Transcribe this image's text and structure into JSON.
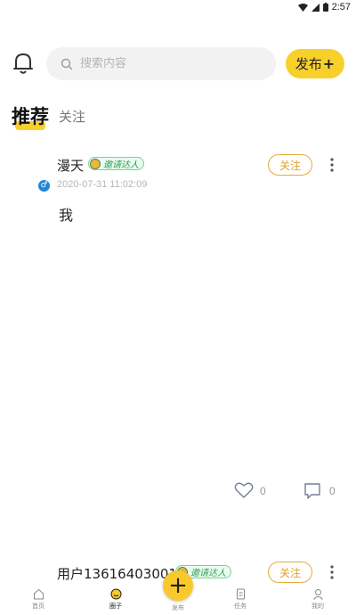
{
  "status_bar": {
    "time": "2:57"
  },
  "header": {
    "search_placeholder": "搜索内容",
    "publish_label": "发布",
    "publish_plus": "+"
  },
  "tabs": [
    {
      "label": "推荐",
      "active": true
    },
    {
      "label": "关注",
      "active": false
    }
  ],
  "posts": [
    {
      "username": "漫天",
      "badge": "邀请达人",
      "time": "2020-07-31 11:02:09",
      "content": "我",
      "follow_label": "关注",
      "likes": "0",
      "comments": "0"
    },
    {
      "username": "用户13616403001",
      "badge": "邀请达人",
      "follow_label": "关注"
    }
  ],
  "bottom_nav": [
    {
      "label": "首页",
      "icon": "home-icon",
      "active": false
    },
    {
      "label": "圈子",
      "icon": "circle-icon",
      "active": true
    },
    {
      "label": "发布",
      "icon": "plus-icon",
      "active": false
    },
    {
      "label": "任务",
      "icon": "task-icon",
      "active": false
    },
    {
      "label": "我的",
      "icon": "user-icon",
      "active": false
    }
  ],
  "colors": {
    "accent": "#f8d02a",
    "follow": "#e3ad3a",
    "badge": "#2e9e57"
  }
}
